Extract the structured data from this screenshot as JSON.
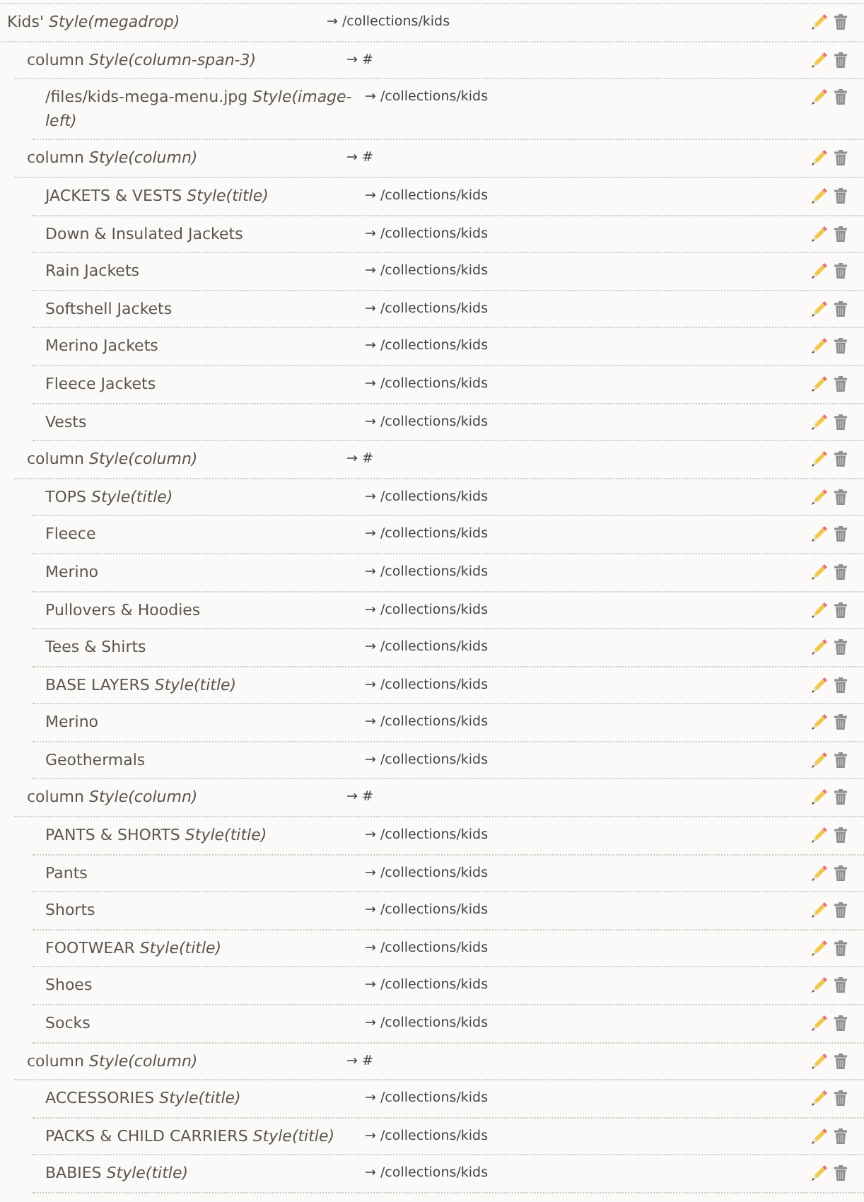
{
  "menu_items": [
    {
      "label": "Kids' *Style(megadrop)*",
      "link": "→ /collections/kids",
      "children": [
        {
          "label": "column *Style(column-span-3)*",
          "link": "→ #",
          "children": [
            {
              "label": "/files/kids-mega-menu.jpg *Style(image-left)*",
              "link": "→ /collections/kids"
            }
          ]
        },
        {
          "label": "column *Style(column)*",
          "link": "→ #",
          "children": [
            {
              "label": "JACKETS & VESTS *Style(title)*",
              "link": "→ /collections/kids"
            },
            {
              "label": "Down & Insulated Jackets",
              "link": "→ /collections/kids"
            },
            {
              "label": "Rain Jackets",
              "link": "→ /collections/kids"
            },
            {
              "label": "Softshell Jackets",
              "link": "→ /collections/kids"
            },
            {
              "label": "Merino Jackets",
              "link": "→ /collections/kids"
            },
            {
              "label": "Fleece Jackets",
              "link": "→ /collections/kids"
            },
            {
              "label": "Vests",
              "link": "→ /collections/kids"
            }
          ]
        },
        {
          "label": "column *Style(column)*",
          "link": "→ #",
          "children": [
            {
              "label": "TOPS *Style(title)*",
              "link": "→ /collections/kids"
            },
            {
              "label": "Fleece",
              "link": "→ /collections/kids"
            },
            {
              "label": "Merino",
              "link": "→ /collections/kids"
            },
            {
              "label": "Pullovers & Hoodies",
              "link": "→ /collections/kids"
            },
            {
              "label": "Tees & Shirts",
              "link": "→ /collections/kids"
            },
            {
              "label": "BASE LAYERS *Style(title)*",
              "link": "→ /collections/kids"
            },
            {
              "label": "Merino",
              "link": "→ /collections/kids"
            },
            {
              "label": "Geothermals",
              "link": "→ /collections/kids"
            }
          ]
        },
        {
          "label": "column *Style(column)*",
          "link": "→ #",
          "children": [
            {
              "label": "PANTS & SHORTS *Style(title)*",
              "link": "→ /collections/kids"
            },
            {
              "label": "Pants",
              "link": "→ /collections/kids"
            },
            {
              "label": "Shorts",
              "link": "→ /collections/kids"
            },
            {
              "label": "FOOTWEAR *Style(title)*",
              "link": "→ /collections/kids"
            },
            {
              "label": "Shoes",
              "link": "→ /collections/kids"
            },
            {
              "label": "Socks",
              "link": "→ /collections/kids"
            }
          ]
        },
        {
          "label": "column *Style(column)*",
          "link": "→ #",
          "children": [
            {
              "label": "ACCESSORIES *Style(title)*",
              "link": "→ /collections/kids"
            },
            {
              "label": "PACKS & CHILD CARRIERS *Style(title)*",
              "link": "→ /collections/kids"
            },
            {
              "label": "BABIES *Style(title)*",
              "link": "→ /collections/kids"
            }
          ]
        }
      ]
    }
  ]
}
